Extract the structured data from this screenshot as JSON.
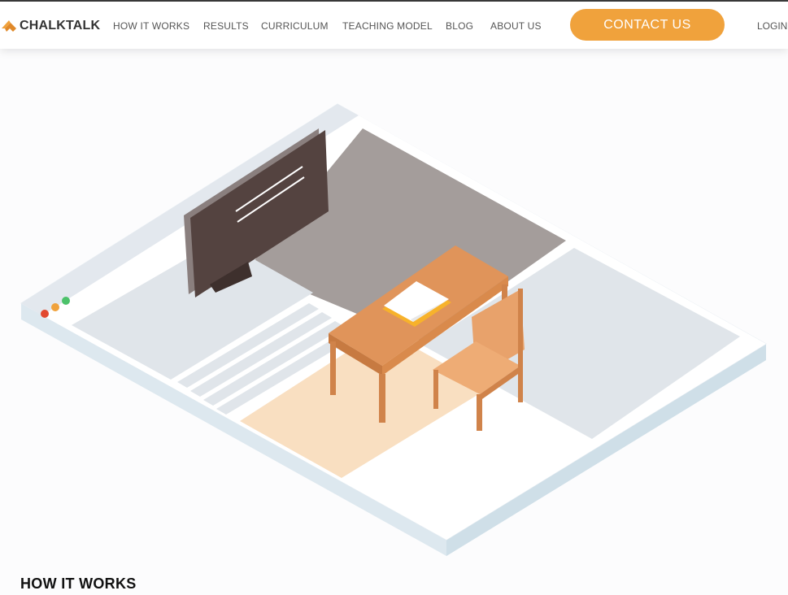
{
  "brand": {
    "name": "CHALKTALK",
    "accent_color": "#f0a23c"
  },
  "nav": {
    "items": [
      {
        "label": "HOW IT WORKS"
      },
      {
        "label": "RESULTS"
      },
      {
        "label": "CURRICULUM"
      },
      {
        "label": "TEACHING MODEL"
      },
      {
        "label": "BLOG"
      },
      {
        "label": "ABOUT US"
      }
    ],
    "contact_label": "CONTACT US",
    "login_label": "LOGIN"
  },
  "hero": {
    "illustration": "isometric-classroom-browser-illustration",
    "window_dot_colors": [
      "#e2492f",
      "#f0a23c",
      "#4cc26a"
    ]
  },
  "section": {
    "heading": "HOW IT WORKS"
  }
}
